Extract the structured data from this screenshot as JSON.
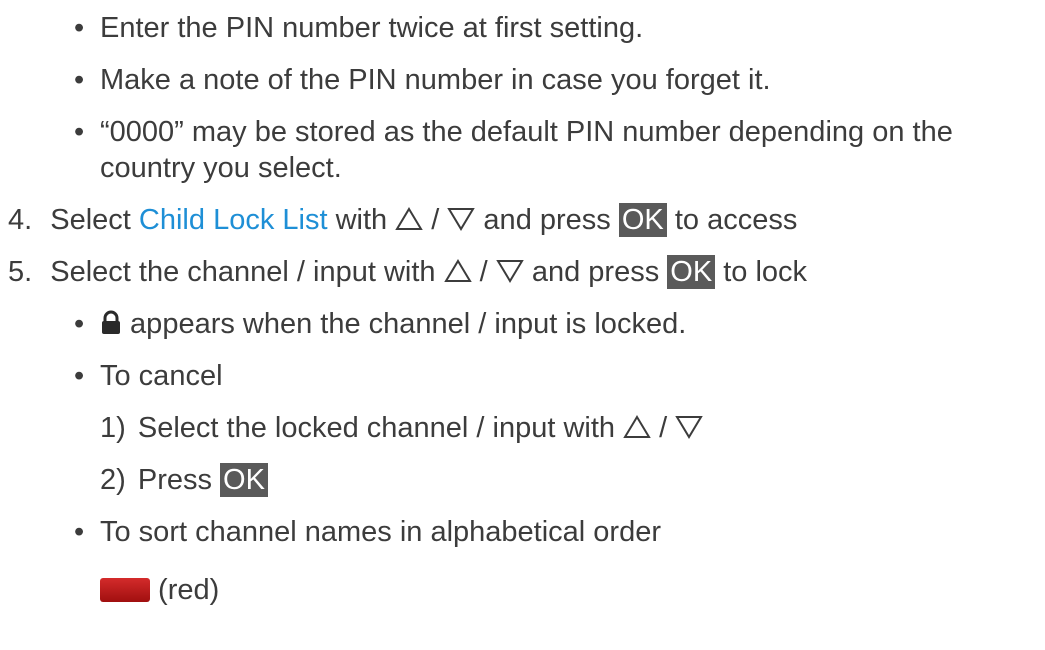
{
  "bullets_top": [
    {
      "text": "Enter the PIN number twice at first setting."
    },
    {
      "text": "Make a note of the PIN number in case you forget it."
    },
    {
      "text_line1": "“0000” may be stored as the default PIN number depending on the",
      "text_line2": "country you select."
    }
  ],
  "step4": {
    "number": "4.",
    "pre": "Select ",
    "link": "Child Lock List",
    "mid": " with ",
    "slash": " / ",
    "post_1": " and press ",
    "ok": "OK",
    "post_2": " to access"
  },
  "step5": {
    "number": "5.",
    "pre": "Select the channel / input with ",
    "slash": " / ",
    "post_1": " and press ",
    "ok": "OK",
    "post_2": " to lock"
  },
  "lock_note": " appears when the channel / input is locked.",
  "cancel": {
    "label": "To cancel",
    "sub1_number": "1)",
    "sub1_text": "Select the locked channel / input with ",
    "sub1_slash": " / ",
    "sub2_number": "2)",
    "sub2_pre": "Press ",
    "sub2_ok": "OK"
  },
  "sort": {
    "label": "To sort channel names in alphabetical order",
    "button_text": " (red)"
  },
  "icons": {
    "bullet": "bullet-dot-icon",
    "up": "up-triangle-icon",
    "down": "down-triangle-icon",
    "lock": "padlock-icon",
    "red_button": "red-button-icon"
  },
  "colors": {
    "text": "#3c3c3c",
    "link": "#1e8fd6",
    "ok_bg": "#5a5a5a",
    "red_button": "#c01a1a"
  }
}
